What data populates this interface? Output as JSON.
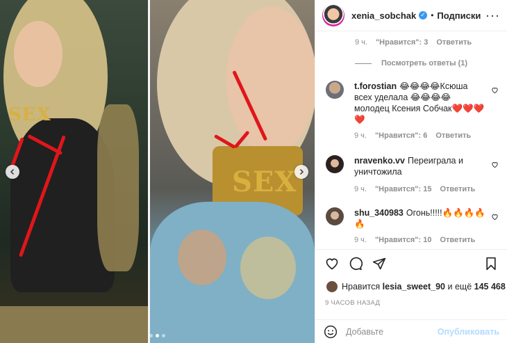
{
  "header": {
    "username": "xenia_sobchak",
    "separator": "•",
    "follow_label": "Подписки",
    "more_label": "···"
  },
  "top_meta": {
    "time": "9 ч.",
    "likes": "\"Нравится\": 3",
    "reply": "Ответить"
  },
  "view_replies": "Посмотреть ответы (1)",
  "comments": [
    {
      "username": "t.forostian",
      "text": "😂😂😂😂Ксюша всех уделала 😂😂😂😂 молодец Ксения Собчак❤️❤️❤️❤️",
      "time": "9 ч.",
      "likes": "\"Нравится\": 6",
      "reply": "Ответить"
    },
    {
      "username": "nravenko.vv",
      "text": "Переиграла и уничтожила",
      "time": "9 ч.",
      "likes": "\"Нравится\": 15",
      "reply": "Ответить"
    },
    {
      "username": "shu_340983",
      "text": "Огонь!!!!!🔥🔥🔥🔥🔥",
      "time": "9 ч.",
      "likes": "\"Нравится\": 10",
      "reply": "Ответить"
    }
  ],
  "likes": {
    "prefix": "Нравится",
    "user": "lesia_sweet_90",
    "middle": "и ещё",
    "count": "145 468"
  },
  "posted_ago": "9 ЧАСОВ НАЗАД",
  "add_comment": {
    "placeholder": "Добавьте",
    "publish": "Опубликовать"
  },
  "media": {
    "left_text": "SEX",
    "right_text": "SEX"
  },
  "colors": {
    "accent": "#3897f0",
    "publish_disabled": "#b3dbff",
    "arrow": "#e0161a"
  }
}
